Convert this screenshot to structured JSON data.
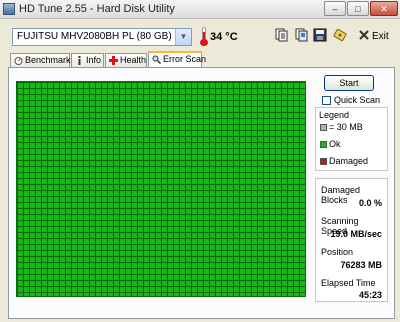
{
  "window": {
    "title": "HD Tune 2.55 - Hard Disk Utility",
    "min_glyph": "–",
    "max_glyph": "□",
    "close_glyph": "✕"
  },
  "toolbar": {
    "drive": "FUJITSU MHV2080BH PL (80 GB)",
    "temperature": "34 °C",
    "exit_label": "Exit",
    "icons": [
      "copy-text-icon",
      "copy-screenshot-icon",
      "save-icon",
      "options-icon",
      "exit-icon"
    ]
  },
  "tabs": [
    {
      "label": "Benchmark",
      "icon": "gauge-icon",
      "active": false
    },
    {
      "label": "Info",
      "icon": "info-icon",
      "active": false
    },
    {
      "label": "Health",
      "icon": "health-cross-icon",
      "active": false
    },
    {
      "label": "Error Scan",
      "icon": "magnifier-icon",
      "active": true
    }
  ],
  "scan": {
    "start_label": "Start",
    "quick_scan_label": "Quick Scan",
    "quick_scan_checked": false
  },
  "legend": {
    "title": "Legend",
    "items": [
      {
        "label": "= 30 MB",
        "color": "#b0b0b0"
      },
      {
        "label": "Ok",
        "color": "#16b816"
      },
      {
        "label": "Damaged",
        "color": "#c01818"
      }
    ]
  },
  "stats": {
    "damaged_blocks_label": "Damaged Blocks",
    "damaged_blocks_value": "0.0 %",
    "scanning_speed_label": "Scanning Speed",
    "scanning_speed_value": "19.0 MB/sec",
    "position_label": "Position",
    "position_value": "76283 MB",
    "elapsed_label": "Elapsed Time",
    "elapsed_value": "45:23"
  },
  "colors": {
    "ok_block": "#16b816",
    "damaged_block": "#c01818",
    "active_tab_accent": "#f6b93a"
  }
}
